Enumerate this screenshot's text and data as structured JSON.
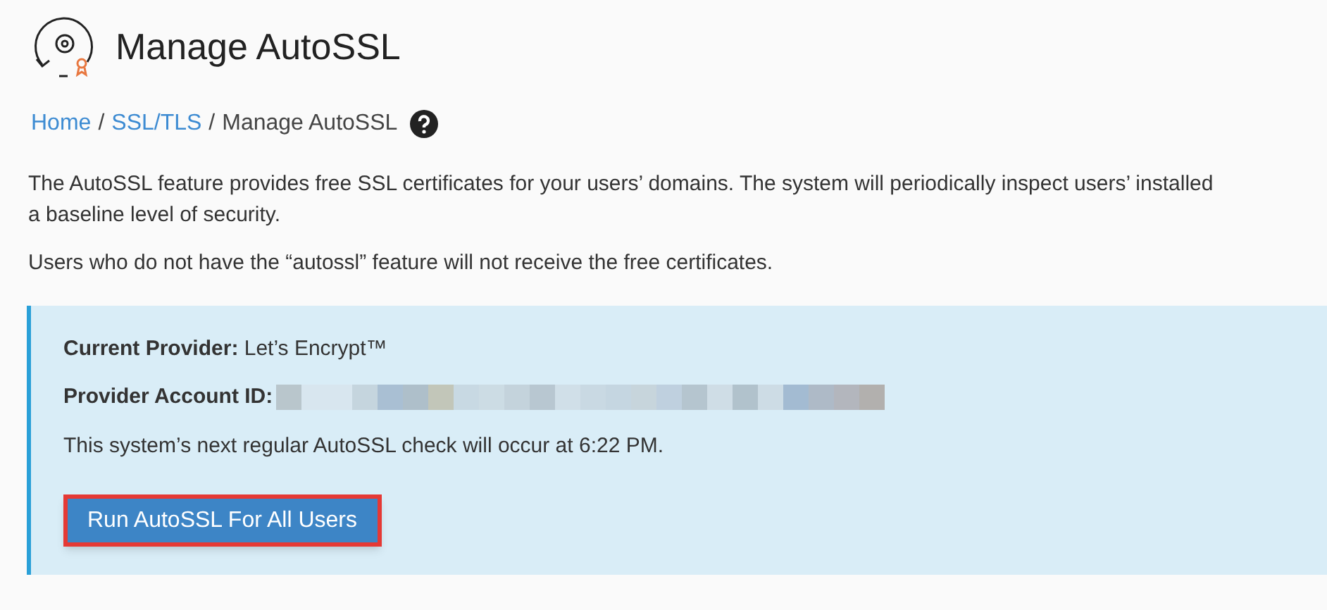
{
  "page_title": "Manage AutoSSL",
  "breadcrumb": [
    {
      "label": "Home",
      "kind": "link"
    },
    {
      "label": "/",
      "kind": "separator"
    },
    {
      "label": "SSL/TLS",
      "kind": "link"
    },
    {
      "label": "/",
      "kind": "separator"
    },
    {
      "label": "Manage AutoSSL",
      "kind": "current"
    }
  ],
  "description_lines": [
    "The AutoSSL feature provides free SSL certificates for your users’ domains. The system will periodically inspect users’ installed",
    "a baseline level of security."
  ],
  "note": "Users who do not have the “autossl” feature will not receive the free certificates.",
  "panel": {
    "provider_label": "Current Provider:",
    "provider": "Let’s Encrypt™",
    "account_label": "Provider Account ID:",
    "account_redacted": true,
    "schedule": "This system’s next regular AutoSSL check will occur at 6:22 PM.",
    "button": {
      "label": "Run AutoSSL For All Users",
      "highlighted": true
    }
  }
}
